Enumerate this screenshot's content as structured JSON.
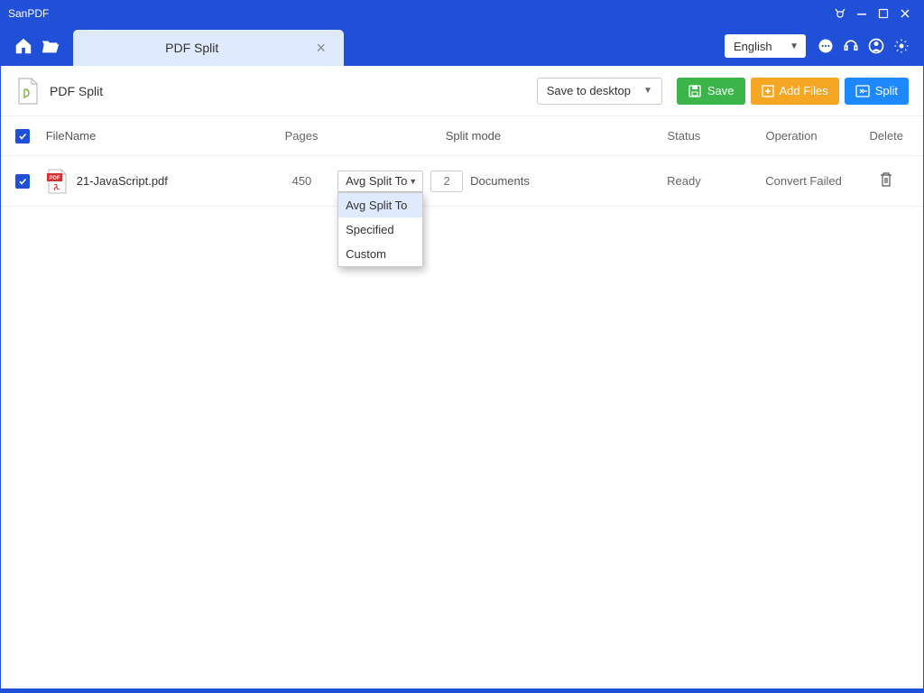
{
  "app": {
    "title": "SanPDF"
  },
  "tab": {
    "label": "PDF Split"
  },
  "language": {
    "selected": "English"
  },
  "page": {
    "title": "PDF Split"
  },
  "toolbar": {
    "save_to": "Save to desktop",
    "save": "Save",
    "add_files": "Add Files",
    "split": "Split"
  },
  "columns": {
    "filename": "FileName",
    "pages": "Pages",
    "split_mode": "Split mode",
    "status": "Status",
    "operation": "Operation",
    "delete": "Delete"
  },
  "row": {
    "filename": "21-JavaScript.pdf",
    "pages": "450",
    "split_selected": "Avg Split To",
    "count_placeholder": "2",
    "count_suffix": "Documents",
    "status": "Ready",
    "operation": "Convert Failed"
  },
  "dropdown": {
    "opt1": "Avg Split To",
    "opt2": "Specified",
    "opt3": "Custom"
  }
}
